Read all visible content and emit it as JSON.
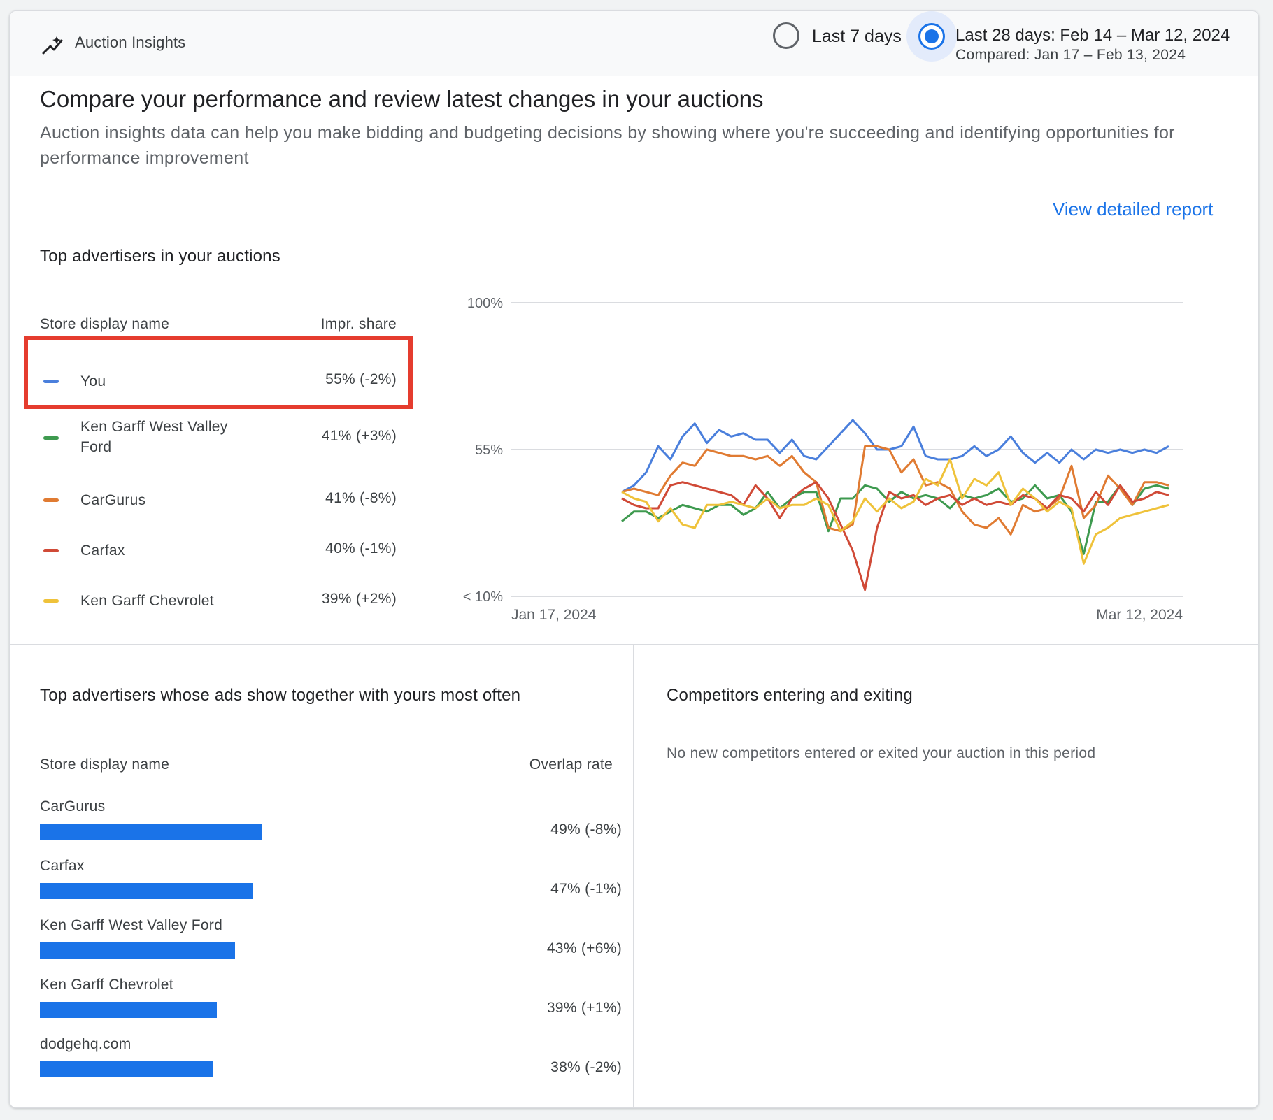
{
  "header": {
    "title": "Auction Insights",
    "title_icon": "trending-icon",
    "option_7": "Last 7 days",
    "option_28": "Last 28 days: Feb 14 – Mar 12, 2024",
    "option_28_compared": "Compared: Jan 17 – Feb 13, 2024",
    "selected_option": "Last 28 days"
  },
  "intro": {
    "title": "Compare your performance and review latest changes in your auctions",
    "description": "Auction insights data can help you make bidding and budgeting decisions by showing where you're succeeding and identifying opportunities for performance improvement",
    "view_report": "View detailed report"
  },
  "top_advertisers": {
    "title": "Top advertisers in your auctions",
    "col_name": "Store display name",
    "col_value": "Impr. share",
    "rows": [
      {
        "name": "You",
        "value": "55% (-2%)",
        "color": "#4a7fdc"
      },
      {
        "name": "Ken Garff West Valley Ford",
        "value": "41% (+3%)",
        "color": "#3e9a4f"
      },
      {
        "name": "CarGurus",
        "value": "41% (-8%)",
        "color": "#e07b32"
      },
      {
        "name": "Carfax",
        "value": "40% (-1%)",
        "color": "#d04a37"
      },
      {
        "name": "Ken Garff Chevrolet",
        "value": "39% (+2%)",
        "color": "#efc23a"
      }
    ]
  },
  "chart_data": {
    "type": "line",
    "x_start_label": "Jan 17, 2024",
    "x_end_label": "Mar 12, 2024",
    "y_tick_labels": [
      "100%",
      "55%",
      "< 10%"
    ],
    "ylim": [
      10,
      100
    ],
    "grid": true,
    "x_count": 46,
    "series": [
      {
        "name": "You",
        "color": "#4a7fdc",
        "values": [
          42,
          44,
          48,
          56,
          52,
          59,
          63,
          57,
          61,
          59,
          60,
          58,
          58,
          54,
          58,
          53,
          52,
          56,
          60,
          64,
          60,
          55,
          55,
          56,
          62,
          53,
          52,
          52,
          53,
          56,
          53,
          55,
          59,
          54,
          51,
          54,
          51,
          55,
          52,
          55,
          54,
          55,
          54,
          55,
          54,
          56
        ]
      },
      {
        "name": "Ken Garff West Valley Ford",
        "color": "#3e9a4f",
        "values": [
          33,
          36,
          36,
          34,
          36,
          38,
          37,
          36,
          38,
          38,
          35,
          37,
          42,
          37,
          40,
          42,
          42,
          30,
          40,
          40,
          44,
          43,
          39,
          42,
          40,
          41,
          40,
          37,
          41,
          40,
          41,
          43,
          39,
          40,
          44,
          40,
          41,
          36,
          23,
          39,
          39,
          44,
          38,
          43,
          44,
          43
        ]
      },
      {
        "name": "CarGurus",
        "color": "#e07b32",
        "values": [
          42,
          43,
          42,
          41,
          47,
          51,
          50,
          55,
          54,
          53,
          53,
          52,
          53,
          50,
          53,
          48,
          45,
          31,
          30,
          32,
          56,
          56,
          55,
          48,
          52,
          44,
          45,
          43,
          36,
          32,
          31,
          34,
          29,
          38,
          36,
          37,
          40,
          50,
          34,
          38,
          47,
          43,
          38,
          45,
          45,
          44
        ]
      },
      {
        "name": "Carfax",
        "color": "#d04a37",
        "values": [
          40,
          38,
          37,
          37,
          44,
          45,
          44,
          43,
          42,
          41,
          38,
          44,
          40,
          34,
          40,
          43,
          45,
          40,
          32,
          24,
          12,
          31,
          42,
          40,
          41,
          38,
          40,
          41,
          38,
          40,
          38,
          39,
          38,
          41,
          40,
          37,
          41,
          40,
          36,
          42,
          38,
          44,
          39,
          40,
          42,
          41
        ]
      },
      {
        "name": "Ken Garff Chevrolet",
        "color": "#efc23a",
        "values": [
          42,
          40,
          39,
          33,
          37,
          32,
          31,
          38,
          38,
          39,
          38,
          37,
          40,
          37,
          38,
          38,
          40,
          38,
          30,
          33,
          40,
          36,
          40,
          37,
          39,
          46,
          44,
          52,
          40,
          46,
          44,
          48,
          38,
          43,
          40,
          36,
          39,
          37,
          20,
          29,
          31,
          34,
          35,
          36,
          37,
          38
        ]
      }
    ]
  },
  "overlap": {
    "title": "Top advertisers whose ads show together with yours most often",
    "col_name": "Store display name",
    "col_value": "Overlap rate",
    "rows": [
      {
        "name": "CarGurus",
        "value": "49% (-8%)",
        "rate": 49
      },
      {
        "name": "Carfax",
        "value": "47% (-1%)",
        "rate": 47
      },
      {
        "name": "Ken Garff West Valley Ford",
        "value": "43% (+6%)",
        "rate": 43
      },
      {
        "name": "Ken Garff Chevrolet",
        "value": "39% (+1%)",
        "rate": 39
      },
      {
        "name": "dodgehq.com",
        "value": "38% (-2%)",
        "rate": 38
      }
    ]
  },
  "competitors": {
    "title": "Competitors entering and exiting",
    "message": "No new competitors entered or exited your auction in this period"
  }
}
